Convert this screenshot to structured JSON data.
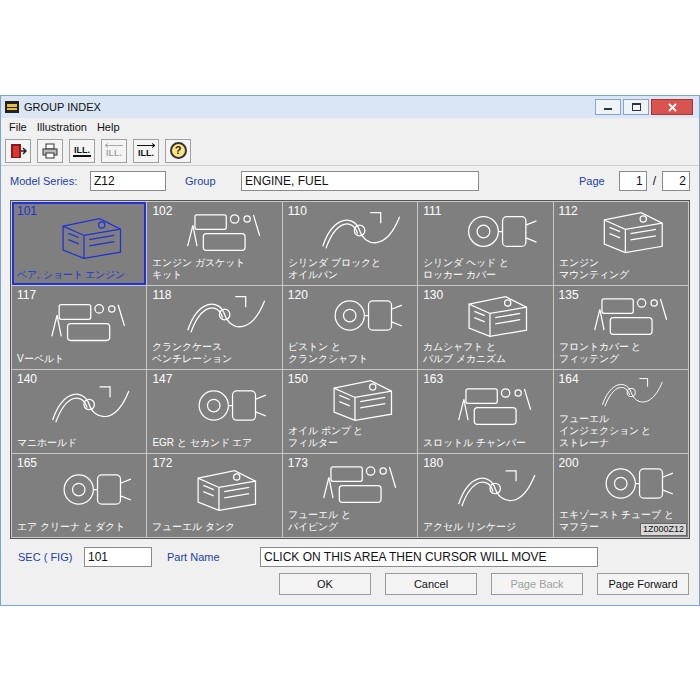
{
  "window": {
    "title": "GROUP INDEX"
  },
  "menu": [
    "File",
    "Illustration",
    "Help"
  ],
  "toolbar": [
    {
      "kind": "exit",
      "label": "",
      "disabled": false
    },
    {
      "kind": "print",
      "label": "",
      "disabled": false
    },
    {
      "kind": "ill",
      "label": "ILL.",
      "disabled": false
    },
    {
      "kind": "ill-back",
      "label": "ILL.",
      "disabled": true
    },
    {
      "kind": "ill-forward",
      "label": "ILL.",
      "disabled": false
    },
    {
      "kind": "help",
      "label": "?",
      "disabled": false
    }
  ],
  "fields": {
    "model_series": {
      "label": "Model Series:",
      "value": "Z12"
    },
    "group": {
      "label": "Group",
      "value": "ENGINE, FUEL"
    },
    "page": {
      "label": "Page",
      "current": "1",
      "separator": "/",
      "total": "2"
    }
  },
  "groups": [
    {
      "number": "101",
      "lines": [
        "ベア, ショート エンジン"
      ],
      "selected": true
    },
    {
      "number": "102",
      "lines": [
        "エンジン ガスケット",
        "キット"
      ],
      "selected": false
    },
    {
      "number": "110",
      "lines": [
        "シリンダ ブロックと",
        "オイルパン"
      ],
      "selected": false
    },
    {
      "number": "111",
      "lines": [
        "シリンダ ヘッド と",
        "ロッカー カバー"
      ],
      "selected": false
    },
    {
      "number": "112",
      "lines": [
        "エンジン",
        "マウンティング"
      ],
      "selected": false
    },
    {
      "number": "117",
      "lines": [
        "Vーベルト"
      ],
      "selected": false
    },
    {
      "number": "118",
      "lines": [
        "クランクケース",
        "ベンチレーション"
      ],
      "selected": false
    },
    {
      "number": "120",
      "lines": [
        "ピストン と",
        "クランクシャフト"
      ],
      "selected": false
    },
    {
      "number": "130",
      "lines": [
        "カムシャフト と",
        "バルブ メカニズム"
      ],
      "selected": false
    },
    {
      "number": "135",
      "lines": [
        "フロントカバー と",
        "フィッテング"
      ],
      "selected": false
    },
    {
      "number": "140",
      "lines": [
        "マニホールド"
      ],
      "selected": false
    },
    {
      "number": "147",
      "lines": [
        "EGR と セカンド エア"
      ],
      "selected": false
    },
    {
      "number": "150",
      "lines": [
        "オイル ポンプ と",
        "フィルター"
      ],
      "selected": false
    },
    {
      "number": "163",
      "lines": [
        "スロットル チャンバー"
      ],
      "selected": false
    },
    {
      "number": "164",
      "lines": [
        "フューエル",
        "インジェクション と",
        "ストレーナ"
      ],
      "selected": false
    },
    {
      "number": "165",
      "lines": [
        "エア クリーナ と ダクト"
      ],
      "selected": false
    },
    {
      "number": "172",
      "lines": [
        "フューエル タンク"
      ],
      "selected": false
    },
    {
      "number": "173",
      "lines": [
        "フューエル と",
        "パイピング"
      ],
      "selected": false
    },
    {
      "number": "180",
      "lines": [
        "アクセル リンケージ"
      ],
      "selected": false
    },
    {
      "number": "200",
      "lines": [
        "エキゾースト チューブ と",
        "マフラー"
      ],
      "selected": false
    }
  ],
  "grid_code": "1Z000Z12",
  "sec": {
    "label": "SEC ( FIG)",
    "value": "101"
  },
  "part_name": {
    "label": "Part Name",
    "value": "CLICK ON THIS AREA THEN CURSOR WILL MOVE"
  },
  "buttons": [
    {
      "label": "OK",
      "disabled": false
    },
    {
      "label": "Cancel",
      "disabled": false
    },
    {
      "label": "Page Back",
      "disabled": true
    },
    {
      "label": "Page Forward",
      "disabled": false
    }
  ]
}
